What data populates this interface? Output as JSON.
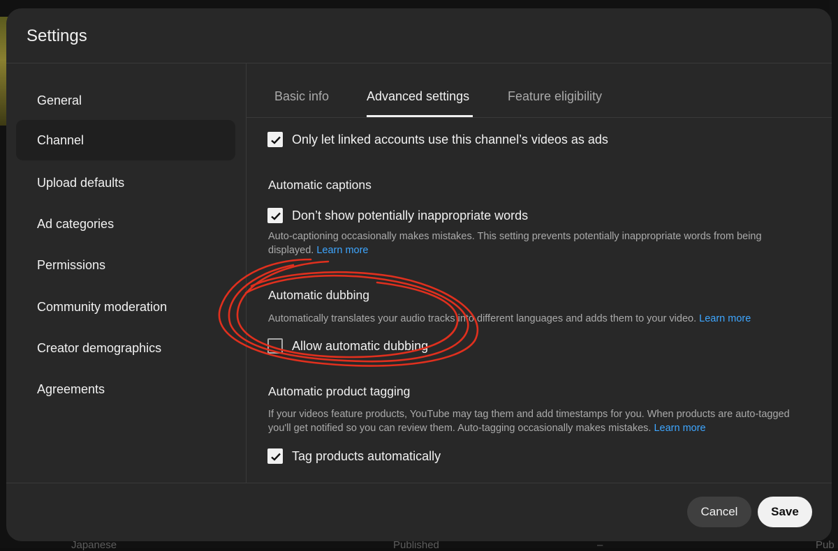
{
  "dialog": {
    "title": "Settings"
  },
  "sidebar": {
    "items": [
      {
        "label": "General"
      },
      {
        "label": "Channel"
      },
      {
        "label": "Upload defaults"
      },
      {
        "label": "Ad categories"
      },
      {
        "label": "Permissions"
      },
      {
        "label": "Community moderation"
      },
      {
        "label": "Creator demographics"
      },
      {
        "label": "Agreements"
      }
    ],
    "active_item": "Channel"
  },
  "tabs": [
    {
      "label": "Basic info"
    },
    {
      "label": "Advanced settings"
    },
    {
      "label": "Feature eligibility"
    }
  ],
  "active_tab": "Advanced settings",
  "content": {
    "linked_ads": {
      "label": "Only let linked accounts use this channel’s videos as ads",
      "checked": true
    },
    "captions": {
      "title": "Automatic captions",
      "checkbox_label": "Don’t show potentially inappropriate words",
      "checked": true,
      "description": "Auto-captioning occasionally makes mistakes. This setting prevents potentially inappropriate words from being displayed.",
      "link": "Learn more"
    },
    "dubbing": {
      "title": "Automatic dubbing",
      "description": "Automatically translates your audio tracks into different languages and adds them to your video.",
      "link": "Learn more",
      "checkbox_label": "Allow automatic dubbing",
      "checked": false
    },
    "product_tagging": {
      "title": "Automatic product tagging",
      "description": "If your videos feature products, YouTube may tag them and add timestamps for you. When products are auto-tagged you'll get notified so you can review them. Auto-tagging occasionally makes mistakes.",
      "link": "Learn more",
      "checkbox_label": "Tag products automatically",
      "checked": true
    }
  },
  "footer": {
    "cancel_label": "Cancel",
    "save_label": "Save"
  },
  "background": {
    "bottom_texts": [
      "Japanese",
      "Published",
      "–",
      "Pub"
    ]
  },
  "colors": {
    "dialog_bg": "#282828",
    "link": "#3ea6ff",
    "annotation": "#e0301e"
  }
}
